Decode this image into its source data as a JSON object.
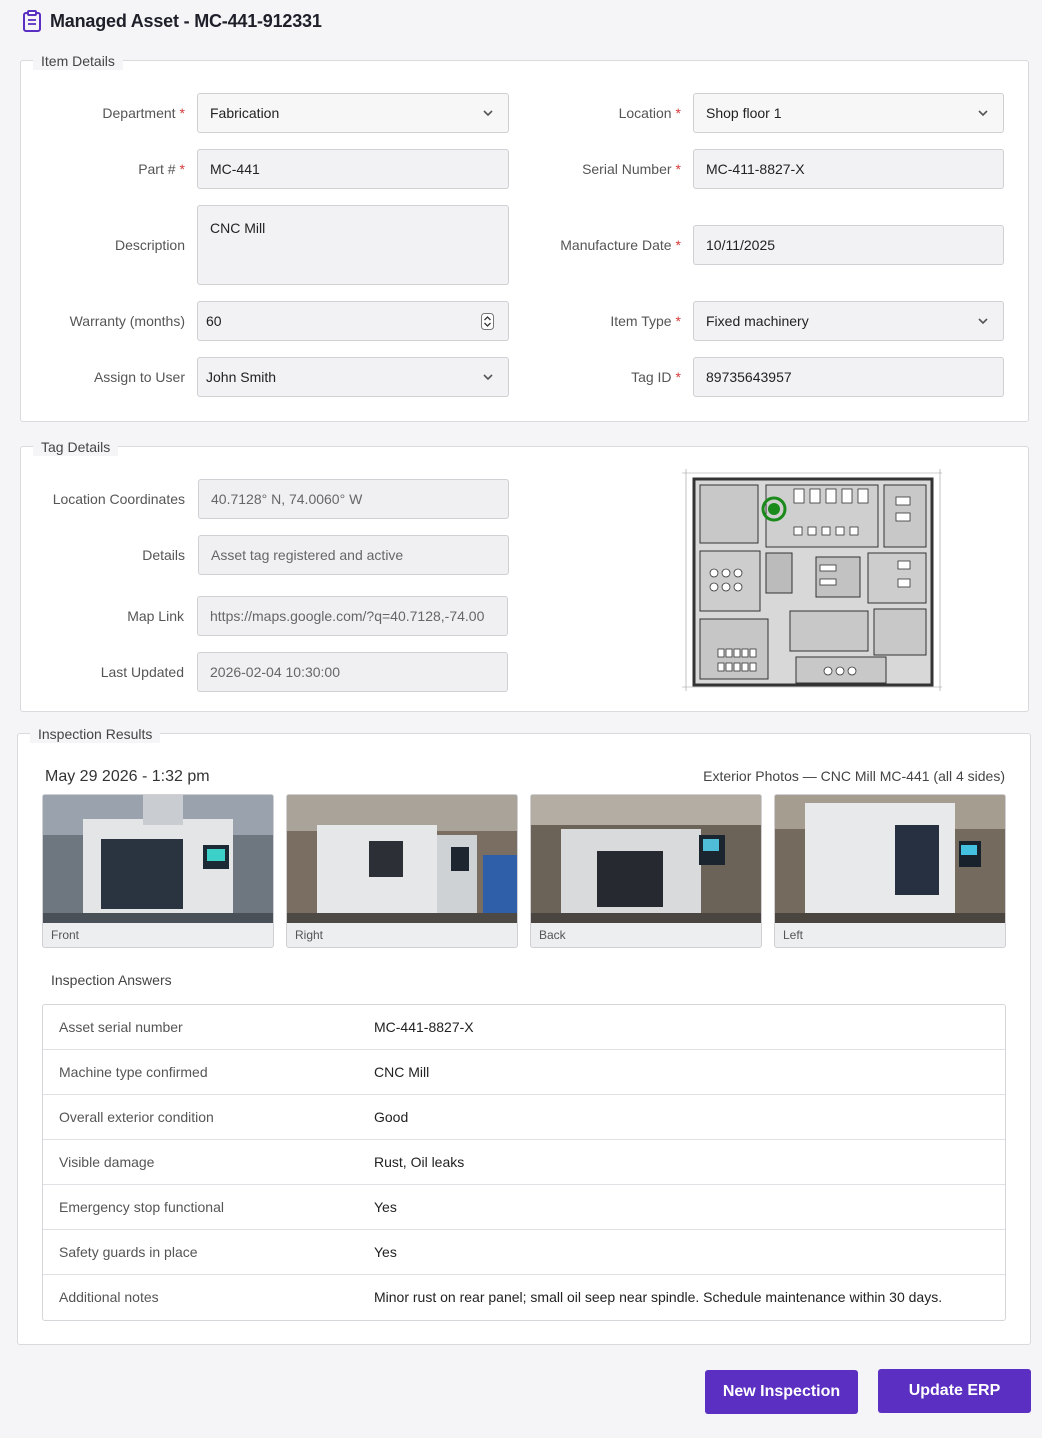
{
  "header": {
    "title": "Managed Asset",
    "separator": " - ",
    "asset_id": "MC-441-912331"
  },
  "item_details": {
    "legend": "Item Details",
    "department": {
      "label": "Department",
      "value": "Fabrication"
    },
    "location": {
      "label": "Location",
      "value": "Shop floor 1"
    },
    "part": {
      "label": "Part #",
      "value": "MC-441"
    },
    "serial": {
      "label": "Serial Number",
      "value": "MC-411-8827-X"
    },
    "description": {
      "label": "Description",
      "value": "CNC Mill"
    },
    "manufacture_date": {
      "label": "Manufacture Date",
      "value": "10/11/2025"
    },
    "warranty": {
      "label": "Warranty (months)",
      "value": "60"
    },
    "item_type": {
      "label": "Item Type",
      "value": "Fixed machinery"
    },
    "assign_user": {
      "label": "Assign to User",
      "value": "John Smith"
    },
    "tag_id": {
      "label": "Tag ID",
      "value": "89735643957"
    },
    "required_mark": "*"
  },
  "tag_details": {
    "legend": "Tag Details",
    "coordinates": {
      "label": "Location Coordinates",
      "value": "40.7128° N, 74.0060° W"
    },
    "details": {
      "label": "Details",
      "value": "Asset tag registered and active"
    },
    "map_link": {
      "label": "Map Link",
      "value": "https://maps.google.com/?q=40.7128,-74.00"
    },
    "last_updated": {
      "label": "Last Updated",
      "value": "2026-02-04 10:30:00"
    }
  },
  "inspection": {
    "legend": "Inspection Results",
    "date": "May 29 2026 - 1:32 pm",
    "caption": "Exterior Photos — CNC Mill MC-441 (all 4 sides)",
    "photos": [
      {
        "caption": "Front"
      },
      {
        "caption": "Right"
      },
      {
        "caption": "Back"
      },
      {
        "caption": "Left"
      }
    ],
    "answers_title": "Inspection Answers",
    "answers": [
      {
        "q": "Asset serial number",
        "a": "MC-441-8827-X"
      },
      {
        "q": "Machine type confirmed",
        "a": "CNC Mill"
      },
      {
        "q": "Overall exterior condition",
        "a": "Good"
      },
      {
        "q": "Visible damage",
        "a": "Rust, Oil leaks"
      },
      {
        "q": "Emergency stop functional",
        "a": "Yes"
      },
      {
        "q": "Safety guards in place",
        "a": "Yes"
      },
      {
        "q": "Additional notes",
        "a": "Minor rust on rear panel; small oil seep near spindle. Schedule maintenance within 30 days."
      }
    ]
  },
  "buttons": {
    "new_inspection": "New Inspection",
    "update_erp": "Update ERP"
  },
  "colors": {
    "accent": "#5a2fc2",
    "required": "#d13a3a",
    "map_marker": "#1a8a1a"
  },
  "icons": {
    "header": "clipboard-icon",
    "select": "chevron-down-icon",
    "stepper": "stepper-icon"
  }
}
